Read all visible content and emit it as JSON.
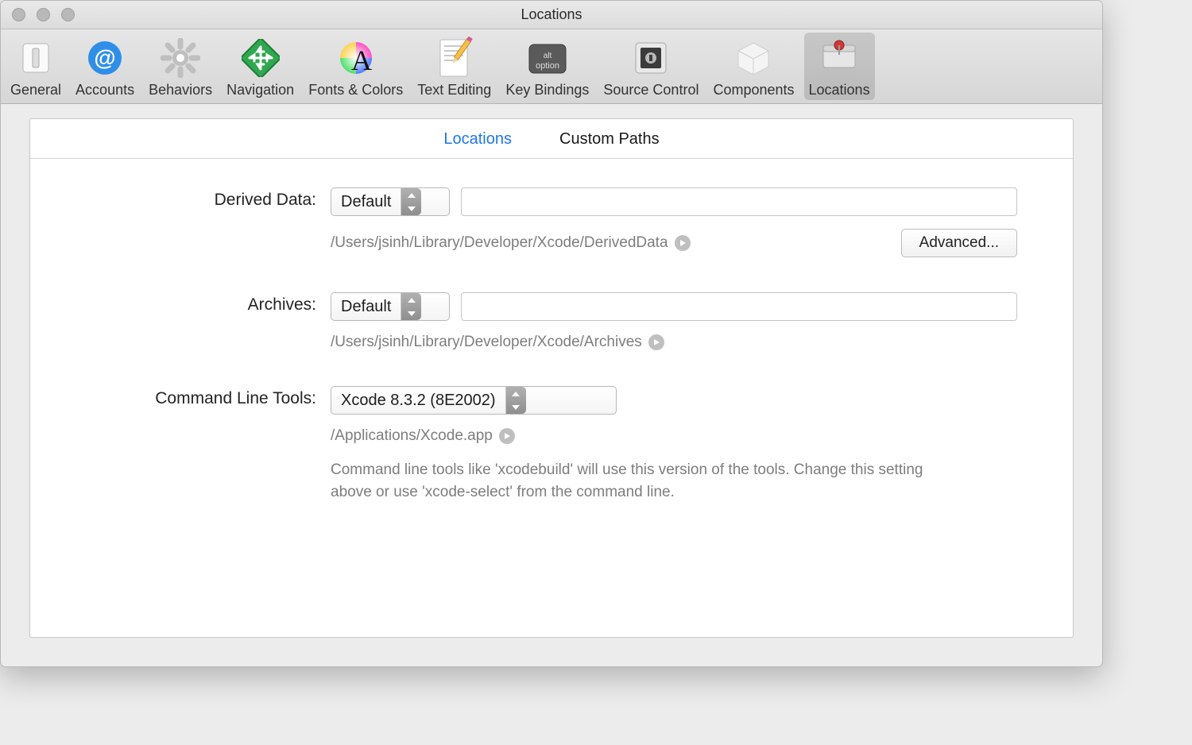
{
  "window": {
    "title": "Locations"
  },
  "toolbar": {
    "items": [
      {
        "label": "General"
      },
      {
        "label": "Accounts"
      },
      {
        "label": "Behaviors"
      },
      {
        "label": "Navigation"
      },
      {
        "label": "Fonts & Colors"
      },
      {
        "label": "Text Editing"
      },
      {
        "label": "Key Bindings"
      },
      {
        "label": "Source Control"
      },
      {
        "label": "Components"
      },
      {
        "label": "Locations"
      }
    ]
  },
  "tabs": {
    "locations": "Locations",
    "custom_paths": "Custom Paths"
  },
  "derived": {
    "label": "Derived Data:",
    "popup": "Default",
    "path": "/Users/jsinh/Library/Developer/Xcode/DerivedData",
    "advanced": "Advanced..."
  },
  "archives": {
    "label": "Archives:",
    "popup": "Default",
    "path": "/Users/jsinh/Library/Developer/Xcode/Archives"
  },
  "clt": {
    "label": "Command Line Tools:",
    "popup": "Xcode 8.3.2 (8E2002)",
    "path": "/Applications/Xcode.app",
    "hint": "Command line tools like 'xcodebuild' will use this version of the tools. Change this setting above or use 'xcode-select' from the command line."
  }
}
